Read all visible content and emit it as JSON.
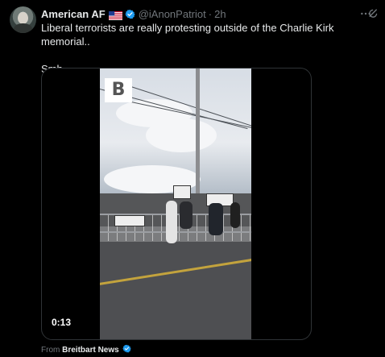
{
  "post": {
    "author_name": "American AF",
    "country_flag": "🇺🇸",
    "handle": "@iAnonPatriot",
    "separator": "·",
    "time": "2h",
    "text": "Liberal terrorists are really protesting outside of the Charlie Kirk memorial..\n\nSmh..",
    "video_duration": "0:13",
    "source_prefix": "From",
    "source_name": "Breitbart News"
  },
  "icons": {
    "verified": "verified-check-icon",
    "more": "more-icon",
    "grok": "grok-icon"
  },
  "colors": {
    "background": "#000000",
    "text_primary": "#e7e9ea",
    "text_secondary": "#71767b",
    "verified_blue": "#1d9bf0",
    "border": "#2f3336"
  }
}
